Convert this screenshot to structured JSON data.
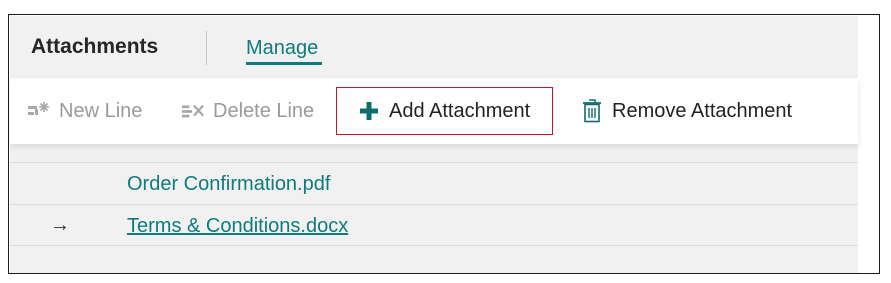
{
  "header": {
    "title": "Attachments",
    "tabs": [
      {
        "label": "Manage",
        "active": true
      }
    ]
  },
  "toolbar": {
    "new_line": {
      "label": "New Line",
      "icon": "new-line-icon",
      "enabled": false
    },
    "delete_line": {
      "label": "Delete Line",
      "icon": "delete-line-icon",
      "enabled": false
    },
    "add_attachment": {
      "label": "Add Attachment",
      "icon": "plus-icon",
      "enabled": true,
      "highlighted": true
    },
    "remove_attachment": {
      "label": "Remove Attachment",
      "icon": "trash-icon",
      "enabled": true
    }
  },
  "attachments": [
    {
      "name": "Order Confirmation.pdf",
      "current": false
    },
    {
      "name": "Terms & Conditions.docx",
      "current": true,
      "marker": "→"
    }
  ],
  "colors": {
    "accent": "#0f7b7b",
    "highlight_border": "#c8102e",
    "disabled_text": "#9a9a9a"
  }
}
